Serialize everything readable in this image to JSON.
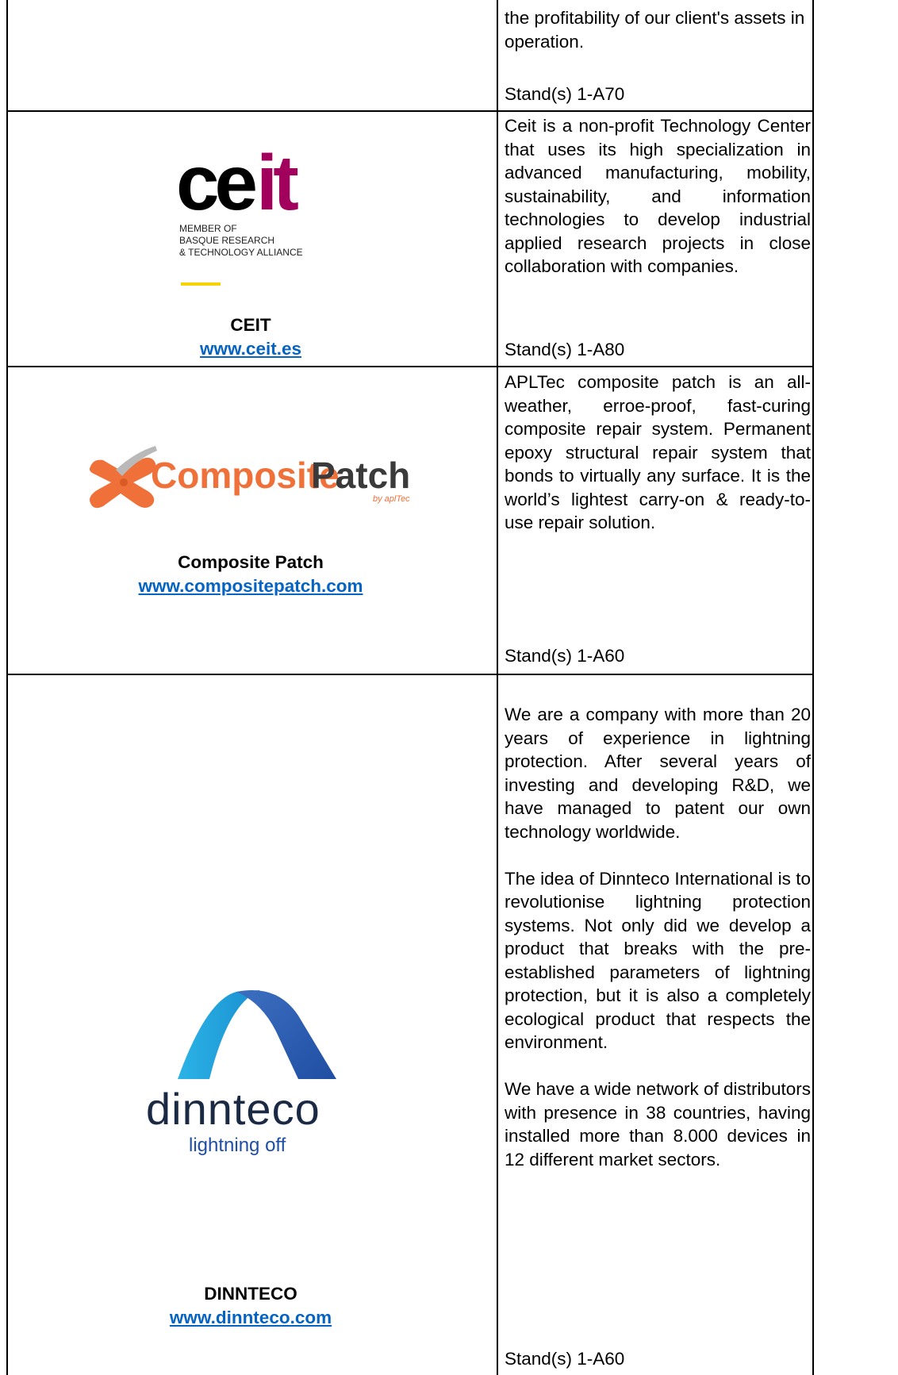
{
  "rows": [
    {
      "description": [
        "the profitability of our client's assets in operation."
      ],
      "stand": "Stand(s) 1-A70"
    },
    {
      "name": "CEIT",
      "url": "www.ceit.es",
      "logo": {
        "wordmark_dark": "ce",
        "wordmark_accent": "it",
        "line1": "MEMBER OF",
        "line2": "BASQUE RESEARCH",
        "line3": "& TECHNOLOGY ALLIANCE",
        "accent_color": "#a1005c",
        "bar_color": "#f5d300"
      },
      "description": [
        "Ceit is a non-profit Technology Center that uses its high specialization in advanced manufacturing, mobility, sustainability, and information technologies to develop industrial applied research projects in close collaboration with companies."
      ],
      "stand": "Stand(s) 1-A80"
    },
    {
      "name": "Composite Patch",
      "url": "www.compositepatch.com",
      "logo": {
        "wordmark_a": "Composite",
        "wordmark_b": "Patch",
        "tagline": "by aplTec",
        "color_a": "#f0703a",
        "color_b": "#3a3a3a"
      },
      "description": [
        "APLTec composite patch is an all-weather, erroe-proof, fast-curing composite repair system. Permanent epoxy structural repair system that bonds to virtually any surface. It is the world’s lightest carry-on  & ready-to-use repair solution."
      ],
      "stand": "Stand(s) 1-A60"
    },
    {
      "name": "DINNTECO",
      "url": "www.dinnteco.com",
      "logo": {
        "wordmark": "dinnteco",
        "tagline": "lightning off",
        "color_light": "#2bb3e6",
        "color_dark": "#1f4ea3",
        "text_color": "#1b2a44"
      },
      "description": [
        "We are a company with more than 20 years of experience in lightning protection. After several years of investing and developing R&D, we have managed to patent our own technology worldwide.",
        "The idea of Dinnteco International is to revolutionise lightning protection systems. Not only did we develop a product that breaks with the pre-established parameters of lightning protection, but it is also a completely ecological product that respects the environment.",
        "We have a wide network of distributors with presence in 38 countries, having installed more than 8.000 devices in 12 different market sectors."
      ],
      "stand": "Stand(s) 1-A60"
    }
  ]
}
